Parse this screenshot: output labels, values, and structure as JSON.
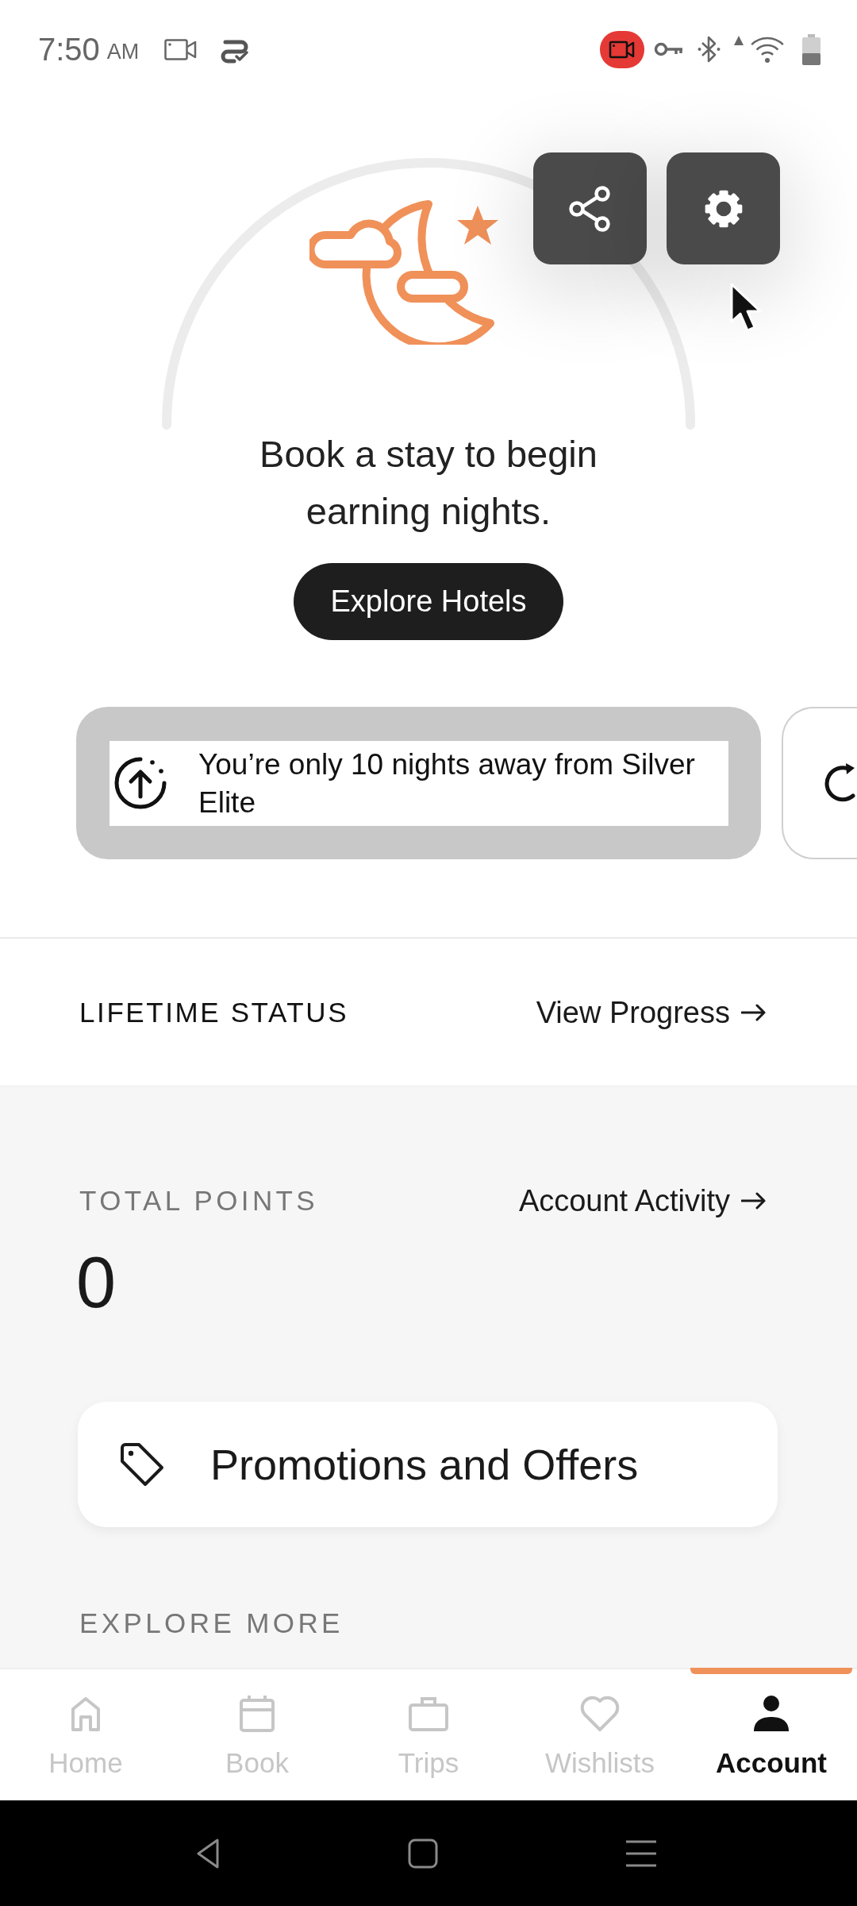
{
  "status_bar": {
    "time": "7:50",
    "meridiem": "AM"
  },
  "hero": {
    "message": "Book a stay to begin earning nights.",
    "button": "Explore Hotels"
  },
  "progress_cards": [
    {
      "text": "You’re only 10 nights away from Silver Elite",
      "selected": true
    },
    {
      "selected": false
    }
  ],
  "lifetime_status": {
    "label": "LIFETIME STATUS",
    "link": "View Progress"
  },
  "points": {
    "label": "TOTAL POINTS",
    "link": "Account Activity",
    "value": "0"
  },
  "promotions": {
    "label": "Promotions and Offers"
  },
  "explore_more": {
    "heading": "EXPLORE MORE"
  },
  "tab_bar": [
    {
      "label": "Home",
      "selected": false
    },
    {
      "label": "Book",
      "selected": false
    },
    {
      "label": "Trips",
      "selected": false
    },
    {
      "label": "Wishlists",
      "selected": false
    },
    {
      "label": "Account",
      "selected": true
    }
  ]
}
